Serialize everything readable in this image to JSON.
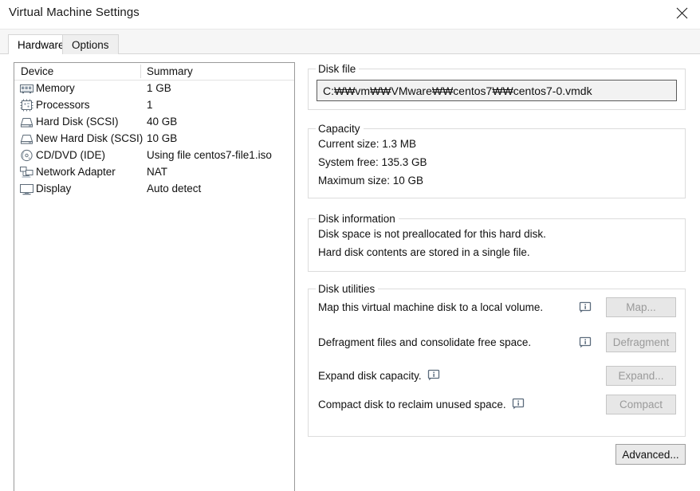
{
  "window": {
    "title": "Virtual Machine Settings",
    "close_icon": "close-icon"
  },
  "tabs": [
    {
      "label": "Hardware",
      "active": true
    },
    {
      "label": "Options",
      "active": false
    }
  ],
  "device_list": {
    "columns": [
      "Device",
      "Summary"
    ],
    "rows": [
      {
        "icon": "memory-icon",
        "device": "Memory",
        "summary": "1 GB"
      },
      {
        "icon": "processor-icon",
        "device": "Processors",
        "summary": "1"
      },
      {
        "icon": "hard-disk-icon",
        "device": "Hard Disk (SCSI)",
        "summary": "40 GB"
      },
      {
        "icon": "hard-disk-icon",
        "device": "New Hard Disk (SCSI)",
        "summary": "10 GB"
      },
      {
        "icon": "cd-dvd-icon",
        "device": "CD/DVD (IDE)",
        "summary": "Using file centos7-file1.iso"
      },
      {
        "icon": "network-adapter-icon",
        "device": "Network Adapter",
        "summary": "NAT"
      },
      {
        "icon": "display-icon",
        "device": "Display",
        "summary": "Auto detect"
      }
    ]
  },
  "disk_file": {
    "legend": "Disk file",
    "path": "C:₩₩vm₩₩VMware₩₩centos7₩₩centos7-0.vmdk"
  },
  "capacity": {
    "legend": "Capacity",
    "current_size": "Current size: 1.3 MB",
    "system_free": "System free: 135.3 GB",
    "maximum_size": "Maximum size: 10 GB"
  },
  "disk_information": {
    "legend": "Disk information",
    "line1": "Disk space is not preallocated for this hard disk.",
    "line2": "Hard disk contents are stored in a single file."
  },
  "disk_utilities": {
    "legend": "Disk utilities",
    "rows": [
      {
        "text": "Map this virtual machine disk to a local volume.",
        "icon": "info-icon",
        "icon_position": "column",
        "button": "Map...",
        "enabled": false
      },
      {
        "text": "Defragment files and consolidate free space.",
        "icon": "info-icon",
        "icon_position": "column",
        "button": "Defragment",
        "enabled": false
      },
      {
        "text": "Expand disk capacity.",
        "icon": "info-icon",
        "icon_position": "inline",
        "button": "Expand...",
        "enabled": false
      },
      {
        "text": "Compact disk to reclaim unused space.",
        "icon": "info-icon",
        "icon_position": "inline",
        "button": "Compact",
        "enabled": false
      }
    ]
  },
  "advanced_button": {
    "label": "Advanced..."
  },
  "colors": {
    "window_bg": "#ffffff",
    "group_border": "#dcdcdc",
    "text": "#111111",
    "disabled_text": "#9a9a9a",
    "button_face": "#e7e7e7",
    "input_bg": "#f2f2f2",
    "info_icon": "#5b6b7c",
    "tabstrip_bg": "#f6f6f6"
  }
}
